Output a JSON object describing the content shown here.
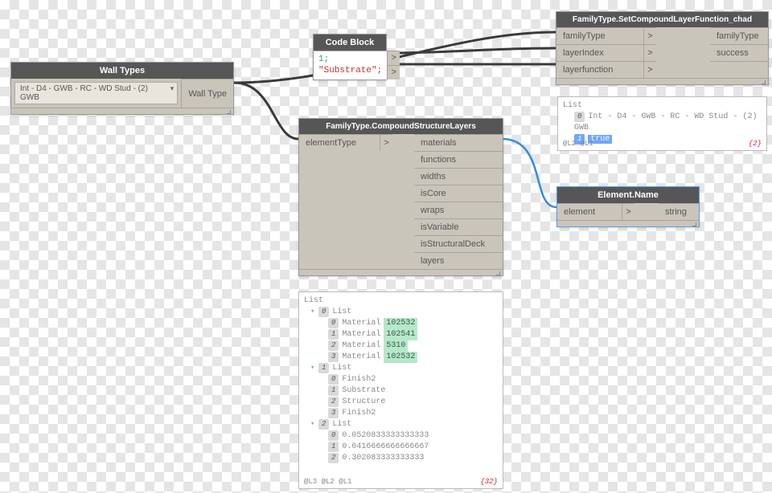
{
  "nodes": {
    "wall_types": {
      "title": "Wall Types",
      "dropdown_value": "Int - D4 - GWB - RC - WD Stud - (2) GWB",
      "output_port": "Wall Type"
    },
    "code_block": {
      "title": "Code Block",
      "lines": [
        "1;",
        "\"Substrate\";"
      ]
    },
    "set_layer": {
      "title": "FamilyType.SetCompoundLayerFunction_chad",
      "inputs": [
        "familyType",
        "layerIndex",
        "layerfunction"
      ],
      "outputs": [
        "familyType",
        "success"
      ]
    },
    "compound_layers": {
      "title": "FamilyType.CompoundStructureLayers",
      "inputs": [
        "elementType"
      ],
      "outputs": [
        "materials",
        "functions",
        "widths",
        "isCore",
        "wraps",
        "isVariable",
        "isStructuralDeck",
        "layers"
      ]
    },
    "element_name": {
      "title": "Element.Name",
      "inputs": [
        "element"
      ],
      "outputs": [
        "string"
      ]
    }
  },
  "previews": {
    "set_layer": {
      "header": "List",
      "rows": [
        {
          "idx": "0",
          "text": "Int - D4 - GWB - RC - WD Stud - (2) GWB",
          "sel": false
        },
        {
          "idx": "1",
          "text": "true",
          "sel": true
        }
      ],
      "levels": "@L2 @L1",
      "count": "{2}"
    },
    "compound_layers": {
      "header": "List",
      "groups": [
        {
          "idx": "0",
          "label": "List",
          "rows": [
            {
              "idx": "0",
              "text": "Material",
              "val": "102532"
            },
            {
              "idx": "1",
              "text": "Material",
              "val": "102541"
            },
            {
              "idx": "2",
              "text": "Material",
              "val": "5310"
            },
            {
              "idx": "3",
              "text": "Material",
              "val": "102532"
            }
          ]
        },
        {
          "idx": "1",
          "label": "List",
          "rows": [
            {
              "idx": "0",
              "text": "Finish2"
            },
            {
              "idx": "1",
              "text": "Substrate"
            },
            {
              "idx": "2",
              "text": "Structure"
            },
            {
              "idx": "3",
              "text": "Finish2"
            }
          ]
        },
        {
          "idx": "2",
          "label": "List",
          "rows": [
            {
              "idx": "0",
              "text": "0.0520833333333333"
            },
            {
              "idx": "1",
              "text": "0.0416666666666667"
            },
            {
              "idx": "2",
              "text": "0.302083333333333"
            }
          ]
        }
      ],
      "levels": "@L3 @L2 @L1",
      "count": "{32}"
    }
  }
}
